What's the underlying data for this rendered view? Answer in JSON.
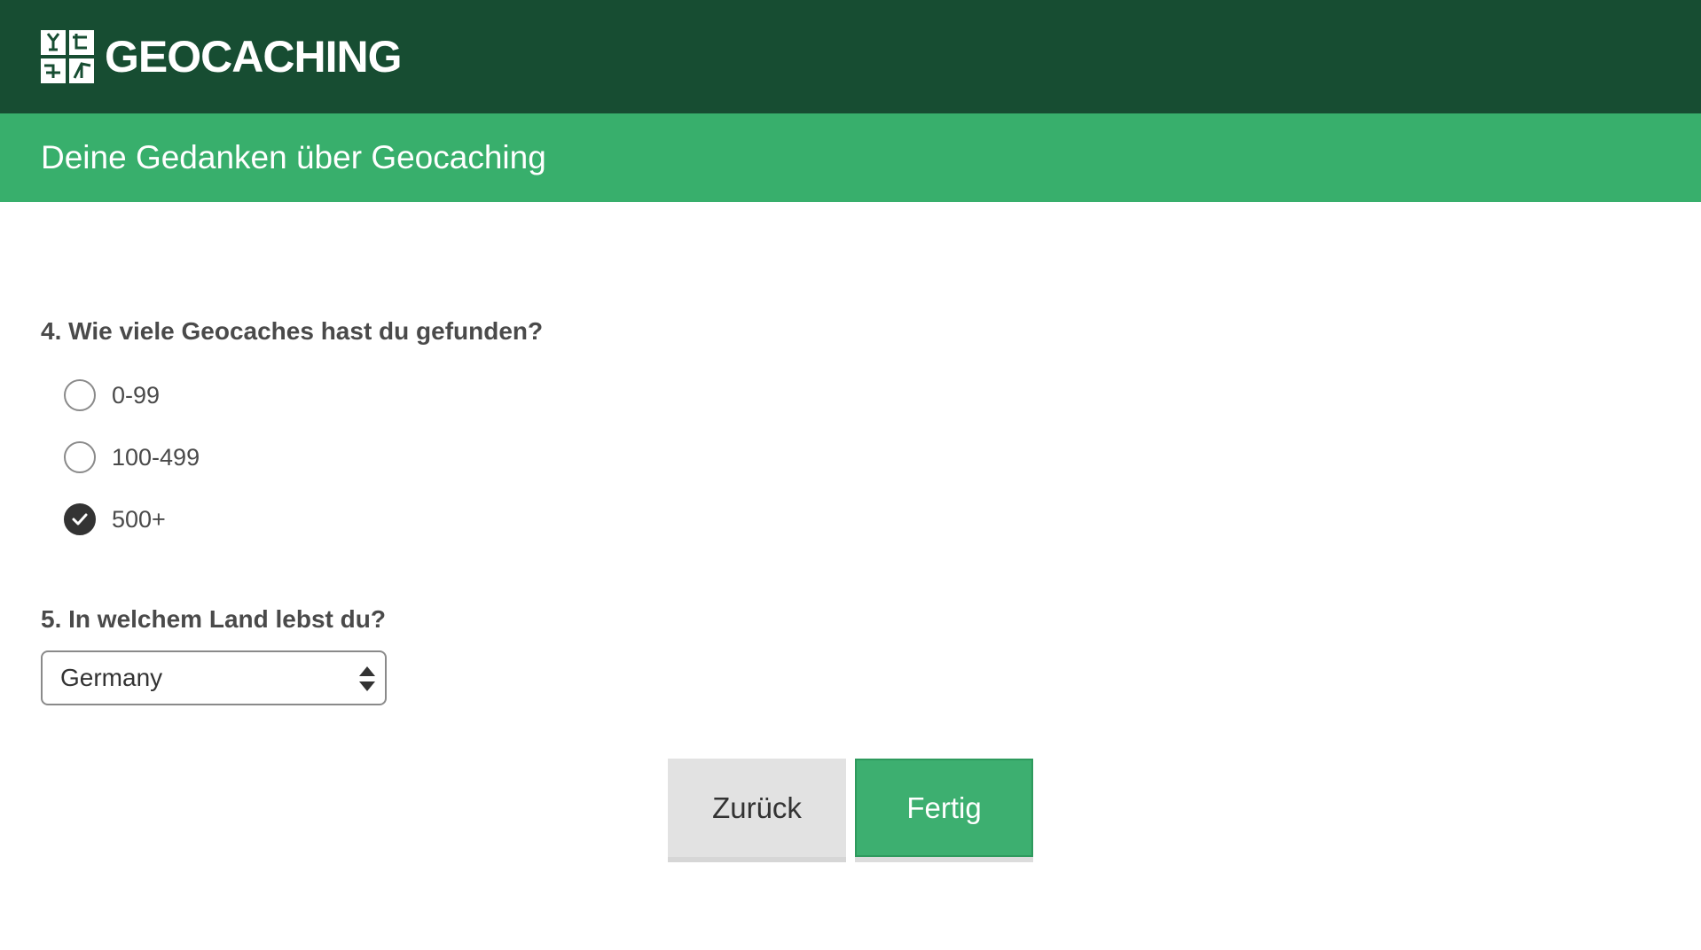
{
  "header": {
    "logo_text": "GEOCACHING",
    "logo_icon": "geocaching-logo-icon",
    "bg_color": "#174d32"
  },
  "subheader": {
    "title": "Deine Gedanken über Geocaching",
    "bg_color": "#38af6c"
  },
  "survey": {
    "question4": {
      "label": "4. Wie viele Geocaches hast du gefunden?",
      "options": [
        {
          "label": "0-99",
          "checked": false
        },
        {
          "label": "100-499",
          "checked": false
        },
        {
          "label": "500+",
          "checked": true
        }
      ]
    },
    "question5": {
      "label": "5. In welchem Land lebst du?",
      "selected": "Germany"
    }
  },
  "actions": {
    "back_label": "Zurück",
    "done_label": "Fertig",
    "done_color": "#3daf70"
  }
}
